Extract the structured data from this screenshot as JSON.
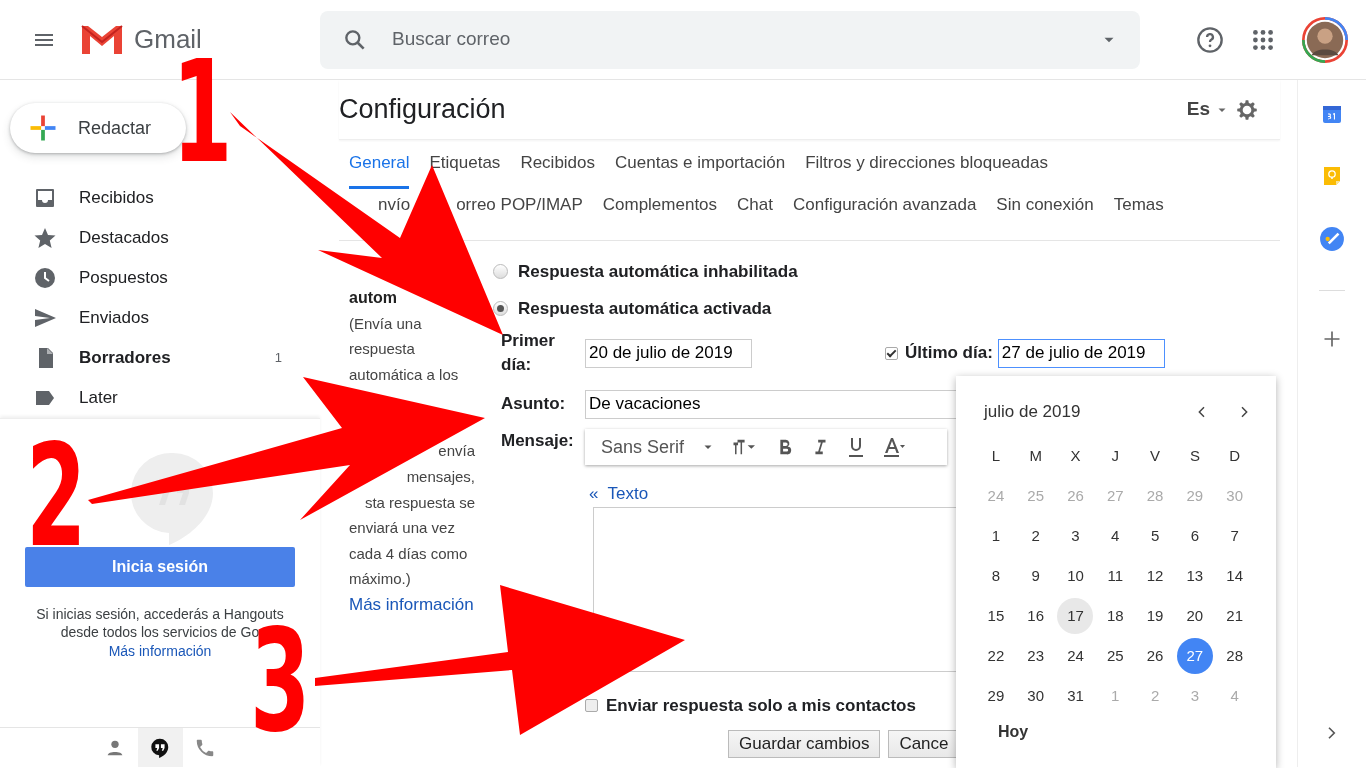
{
  "header": {
    "app_name": "Gmail",
    "search_placeholder": "Buscar correo"
  },
  "compose": "Redactar",
  "sidebar_items": [
    {
      "label": "Recibidos",
      "kind": "inbox",
      "bold": false
    },
    {
      "label": "Destacados",
      "kind": "star",
      "bold": false
    },
    {
      "label": "Pospuestos",
      "kind": "clock",
      "bold": false
    },
    {
      "label": "Enviados",
      "kind": "send",
      "bold": false
    },
    {
      "label": "Borradores",
      "kind": "file",
      "bold": true,
      "count": "1"
    },
    {
      "label": "Later",
      "kind": "label",
      "bold": false
    }
  ],
  "hangouts": {
    "button": "Inicia sesión",
    "text": "Si inicias sesión, accederás a Hangouts desde todos los servicios de Go",
    "link": "Más información",
    "tabs": [
      {
        "kind": "person",
        "selected": false
      },
      {
        "kind": "chat",
        "selected": true
      },
      {
        "kind": "phone",
        "selected": false
      }
    ]
  },
  "settings": {
    "title": "Configuración",
    "language": "Es",
    "tab_rows": [
      [
        {
          "label": "General",
          "selected": true
        },
        {
          "label": "Etiquetas",
          "selected": false
        },
        {
          "label": "Recibidos",
          "selected": false
        },
        {
          "label": "Cuentas e importación",
          "selected": false
        },
        {
          "label": "Filtros y direcciones bloqueadas",
          "selected": false
        }
      ],
      [
        {
          "label": "nvío",
          "selected": false
        },
        {
          "label": "orreo POP/IMAP",
          "selected": false
        },
        {
          "label": "Complementos",
          "selected": false
        },
        {
          "label": "Chat",
          "selected": false
        },
        {
          "label": "Configuración avanzada",
          "selected": false
        },
        {
          "label": "Sin conexión",
          "selected": false
        },
        {
          "label": "Temas",
          "selected": false
        }
      ]
    ]
  },
  "vacation": {
    "heading": "autom",
    "description": [
      {
        "text": "(Envía una",
        "kind": "line"
      },
      {
        "text": "respuesta",
        "kind": "line"
      },
      {
        "text": "automática a los",
        "kind": "line"
      },
      {
        "text": "envía",
        "kind": "gap_tail"
      },
      {
        "text": "mensajes,",
        "kind": "tail"
      },
      {
        "text": "sta respuesta se",
        "kind": "tail"
      },
      {
        "text": "enviará una vez",
        "kind": "line"
      },
      {
        "text": "cada 4 días como",
        "kind": "line"
      },
      {
        "text": "máximo.)",
        "kind": "line"
      }
    ],
    "more_link": "Más información",
    "options": [
      {
        "label": "Respuesta automática inhabilitada",
        "selected": false
      },
      {
        "label": "Respuesta automática activada",
        "selected": true
      }
    ],
    "first_day_label": "Primer día:",
    "first_day": "20 de julio de 2019",
    "last_day": {
      "checked": true,
      "label": "Último día:",
      "value": "27 de julio de 2019"
    },
    "subject_label": "Asunto:",
    "subject": "De vacaciones",
    "message_label": "Mensaje:",
    "font": "Sans Serif",
    "plain_text_link": "«  Texto",
    "contacts_only": {
      "label": "Enviar respuesta solo a mis contactos",
      "checked": false
    },
    "buttons": [
      "Guardar cambios",
      "Cance"
    ]
  },
  "calendar": {
    "month": "julio de 2019",
    "weekdays": [
      "L",
      "M",
      "X",
      "J",
      "V",
      "S",
      "D"
    ],
    "weeks": [
      [
        {
          "day": "24",
          "muted": true
        },
        {
          "day": "25",
          "muted": true
        },
        {
          "day": "26",
          "muted": true
        },
        {
          "day": "27",
          "muted": true
        },
        {
          "day": "28",
          "muted": true
        },
        {
          "day": "29",
          "muted": true
        },
        {
          "day": "30",
          "muted": true
        }
      ],
      [
        {
          "day": "1"
        },
        {
          "day": "2"
        },
        {
          "day": "3"
        },
        {
          "day": "4"
        },
        {
          "day": "5"
        },
        {
          "day": "6"
        },
        {
          "day": "7"
        }
      ],
      [
        {
          "day": "8"
        },
        {
          "day": "9"
        },
        {
          "day": "10"
        },
        {
          "day": "11"
        },
        {
          "day": "12"
        },
        {
          "day": "13"
        },
        {
          "day": "14"
        }
      ],
      [
        {
          "day": "15"
        },
        {
          "day": "16"
        },
        {
          "day": "17",
          "today": true
        },
        {
          "day": "18"
        },
        {
          "day": "19"
        },
        {
          "day": "20"
        },
        {
          "day": "21"
        }
      ],
      [
        {
          "day": "22"
        },
        {
          "day": "23"
        },
        {
          "day": "24"
        },
        {
          "day": "25"
        },
        {
          "day": "26"
        },
        {
          "day": "27",
          "selected": true
        },
        {
          "day": "28"
        }
      ],
      [
        {
          "day": "29"
        },
        {
          "day": "30"
        },
        {
          "day": "31"
        },
        {
          "day": "1",
          "muted": true
        },
        {
          "day": "2",
          "muted": true
        },
        {
          "day": "3",
          "muted": true
        },
        {
          "day": "4",
          "muted": true
        }
      ]
    ],
    "today_button": "Hoy"
  },
  "annotations": [
    "1",
    "2",
    "3"
  ]
}
